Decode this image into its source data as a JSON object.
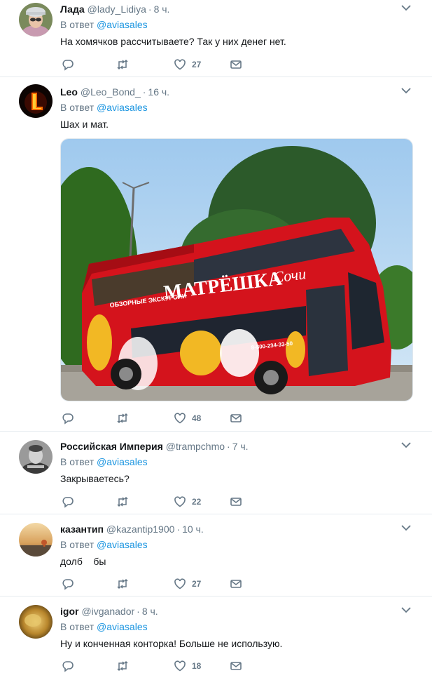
{
  "reply_prefix": "В ответ",
  "tweets": [
    {
      "name": "Лада",
      "handle": "@lady_Lidiya",
      "separator": "·",
      "time": "8 ч.",
      "reply_to": "@aviasales",
      "text": "На хомячков рассчитываете? Так у них денег нет.",
      "likes": "27",
      "has_media": false
    },
    {
      "name": "Leo",
      "handle": "@Leo_Bond_",
      "separator": "·",
      "time": "16 ч.",
      "reply_to": "@aviasales",
      "text": "Шах и мат.",
      "likes": "48",
      "has_media": true,
      "media": {
        "bus_title": "МАТРЁШКА",
        "bus_city": "Сочи",
        "bus_subtitle": "ОБЗОРНЫЕ ЭКСКУРСИИ",
        "bus_phone": "8-800-234-33-50"
      }
    },
    {
      "name": "Российская Империя",
      "handle": "@trampchmo",
      "separator": "·",
      "time": "7 ч.",
      "reply_to": "@aviasales",
      "text": "Закрываетесь?",
      "likes": "22",
      "has_media": false
    },
    {
      "name": "казантип",
      "handle": "@kazantip1900",
      "separator": "·",
      "time": "10 ч.",
      "reply_to": "@aviasales",
      "text": "долб    бы",
      "likes": "27",
      "has_media": false
    },
    {
      "name": "igor",
      "handle": "@ivganador",
      "separator": "·",
      "time": "8 ч.",
      "reply_to": "@aviasales",
      "text": "Ну и конченная конторка! Больше не использую.",
      "likes": "18",
      "has_media": false
    }
  ],
  "colors": {
    "link": "#1b95e0",
    "secondary_text": "#657786",
    "divider": "#e6ecf0",
    "bus_red": "#d4131c"
  },
  "icons": [
    "reply-icon",
    "retweet-icon",
    "like-icon",
    "message-icon",
    "chevron-down-icon"
  ]
}
